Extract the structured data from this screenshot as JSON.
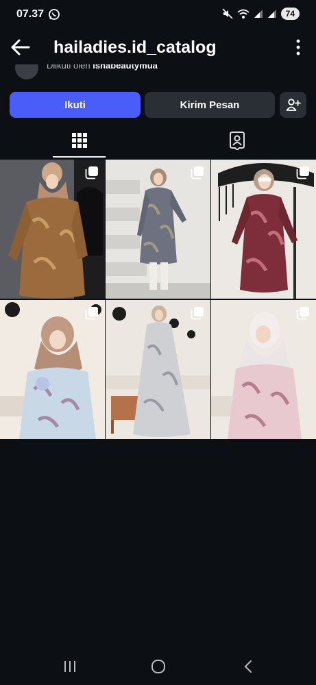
{
  "status_bar": {
    "time": "07.37",
    "battery": "74",
    "icons": [
      "whatsapp-icon",
      "mute-icon",
      "wifi-icon",
      "signal-icon",
      "signal-icon"
    ]
  },
  "header": {
    "title": "hailadies.id_catalog",
    "back_icon": "arrow-left-icon",
    "more_icon": "more-vertical-icon"
  },
  "followed_by": {
    "prefix": "Diikuti oleh",
    "name": "ishabeautymua"
  },
  "actions": {
    "follow_label": "Ikuti",
    "message_label": "Kirim Pesan",
    "add_icon": "add-person-icon"
  },
  "tabs": [
    {
      "icon": "grid-icon",
      "active": true
    },
    {
      "icon": "tagged-icon",
      "active": false
    }
  ],
  "posts": [
    {
      "description": "Model in beige hijab wearing brown batik tunic",
      "multi": true
    },
    {
      "description": "Model in grey batik tunic standing on stairs",
      "multi": true
    },
    {
      "description": "Model in red batik tunic under black umbrella",
      "multi": true
    },
    {
      "description": "Model in light blue floral tunic with peach hijab",
      "multi": true
    },
    {
      "description": "Model in grey floral dress full length",
      "multi": true
    },
    {
      "description": "Model in pink floral tunic with white hijab",
      "multi": true
    }
  ],
  "colors": {
    "background": "#0c1014",
    "follow_button": "#4a5df9",
    "secondary_button": "#2a2f36"
  },
  "nav_icons": [
    "recent-apps-icon",
    "home-icon",
    "back-icon"
  ]
}
